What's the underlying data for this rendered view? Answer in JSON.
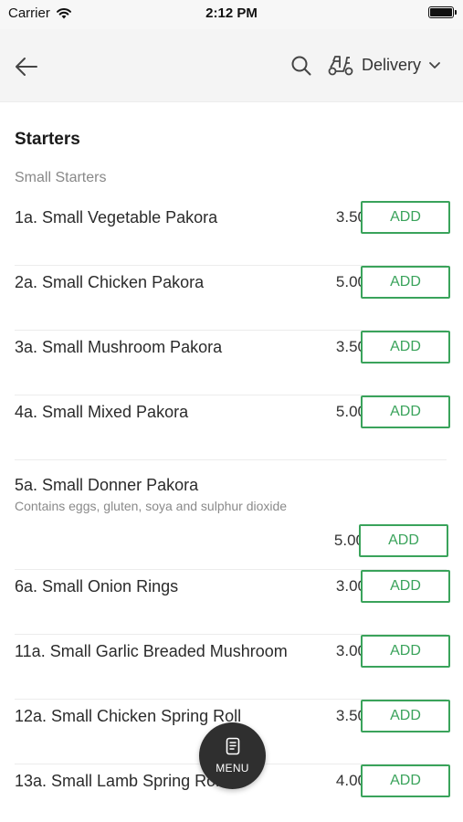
{
  "status_bar": {
    "carrier": "Carrier",
    "time": "2:12 PM"
  },
  "nav": {
    "delivery_label": "Delivery"
  },
  "menu": {
    "section_title": "Starters",
    "subsection_title": "Small Starters",
    "add_label": "ADD",
    "items": [
      {
        "name": "1a. Small Vegetable Pakora",
        "price": "3.50"
      },
      {
        "name": "2a. Small Chicken Pakora",
        "price": "5.00"
      },
      {
        "name": "3a. Small Mushroom Pakora",
        "price": "3.50"
      },
      {
        "name": "4a. Small Mixed Pakora",
        "price": "5.00"
      },
      {
        "name": "5a. Small Donner Pakora",
        "description": "Contains eggs, gluten, soya and sulphur dioxide",
        "price": "5.00"
      },
      {
        "name": "6a. Small Onion Rings",
        "price": "3.00"
      },
      {
        "name": "11a. Small Garlic Breaded Mushroom",
        "price": "3.00"
      },
      {
        "name": "12a. Small Chicken Spring Roll",
        "price": "3.50"
      },
      {
        "name": "13a. Small Lamb Spring Roll",
        "price": "4.00"
      }
    ]
  },
  "fab": {
    "label": "MENU"
  },
  "colors": {
    "accent": "#3aa35b",
    "fab_bg": "#2f2f2f"
  },
  "icons": {
    "back": "arrow-left",
    "search": "magnifier",
    "delivery": "scooter",
    "chevron": "chevron-down",
    "fab": "menu-card"
  }
}
